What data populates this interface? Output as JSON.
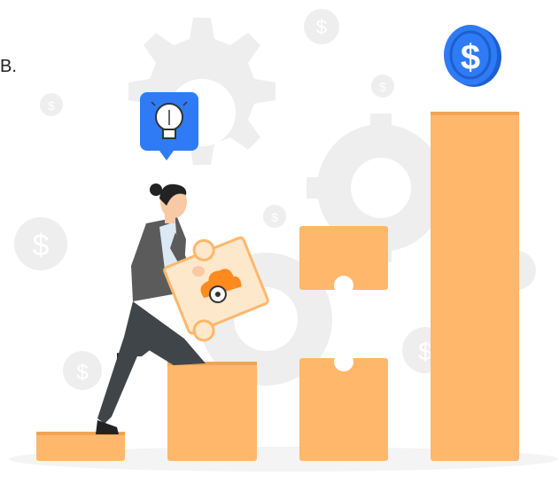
{
  "corner_text": "B.",
  "icons": {
    "top_coin": "dollar-coin-icon",
    "idea": "lightbulb-icon",
    "puzzle_badge": "cloud-gear-icon",
    "bg_coins": "dollar-coin-icon",
    "gears": "gear-icon"
  },
  "colors": {
    "bar": "#ffb76b",
    "bar_shadow": "#f2a455",
    "coin_blue": "#2f7bf5",
    "gear_gray": "#eeeeee",
    "puzzle": "#fde8cc",
    "puzzle_stroke": "#ffb76b",
    "accent_orange": "#ff8a1f",
    "suit": "#5b5b5b",
    "pants": "#3f4548"
  },
  "currency_symbol": "$"
}
